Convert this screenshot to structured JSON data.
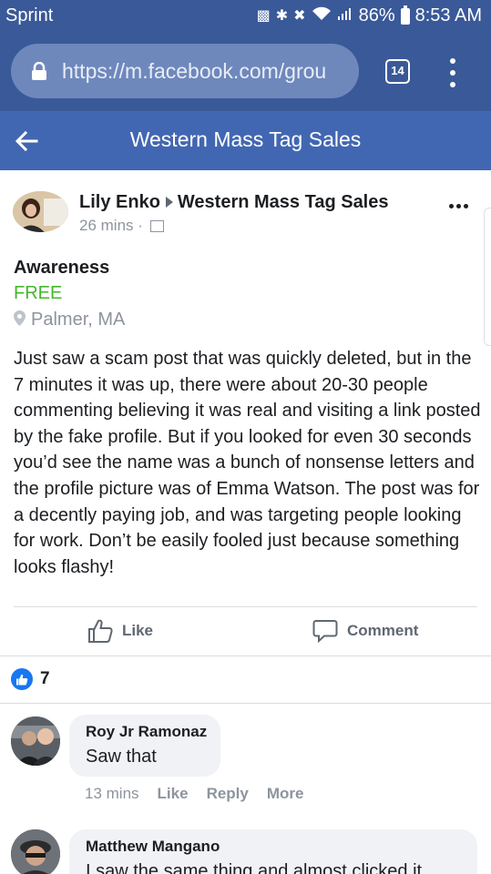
{
  "status_bar": {
    "carrier": "Sprint",
    "battery": "86%",
    "time": "8:53 AM"
  },
  "browser": {
    "url": "https://m.facebook.com/grou",
    "tab_count": "14"
  },
  "header": {
    "title": "Western Mass Tag Sales"
  },
  "post": {
    "author": "Lily Enko",
    "group": "Western Mass Tag Sales",
    "time": "26 mins",
    "meta_separator": "·",
    "listing_title": "Awareness",
    "price": "FREE",
    "location": "Palmer, MA",
    "body": "Just saw a scam post that was quickly deleted, but in the 7 minutes it was up, there were about 20-30 people commenting believing it was real and visiting a link posted by the fake profile. But if you looked for even 30 seconds you’d see the name was a bunch of nonsense letters and the profile picture was of Emma Watson. The post was for a decently paying job, and was targeting people looking for work. Don’t be easily fooled just because something looks flashy!",
    "like_label": "Like",
    "comment_label": "Comment",
    "reaction_count": "7"
  },
  "comments": [
    {
      "name": "Roy Jr Ramonaz",
      "text": "Saw that",
      "time": "13 mins",
      "like": "Like",
      "reply": "Reply",
      "more": "More"
    },
    {
      "name": "Matthew Mangano",
      "text": "I saw the same thing and almost clicked it"
    }
  ],
  "colors": {
    "browser_chrome": "#3a5998",
    "header_blue": "#4267b2",
    "price_green": "#42b72a",
    "like_blue": "#1877f2"
  },
  "icons": [
    "lock-icon",
    "tabs-icon",
    "menu-icon",
    "back-arrow-icon",
    "arrow-right-icon",
    "group-icon",
    "more-options-icon",
    "location-pin-icon",
    "like-icon",
    "comment-icon",
    "like-reaction-icon"
  ]
}
